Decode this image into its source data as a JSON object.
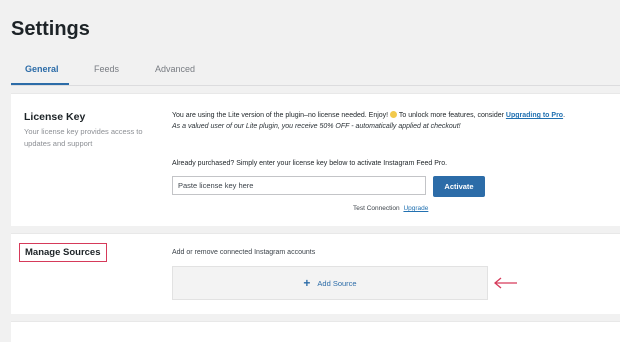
{
  "page": {
    "title": "Settings"
  },
  "tabs": [
    {
      "label": "General",
      "active": true
    },
    {
      "label": "Feeds",
      "active": false
    },
    {
      "label": "Advanced",
      "active": false
    }
  ],
  "license": {
    "title": "License Key",
    "description": "Your license key provides access to updates and support",
    "notice_prefix": "You are using the Lite version of the plugin–no license needed. Enjoy!",
    "notice_middle": " To unlock more features, consider ",
    "upgrade_link": "Upgrading to Pro",
    "notice_period": ".",
    "notice_line2": "As a valued user of our Lite plugin, you receive 50% OFF - automatically applied at checkout!",
    "already": "Already purchased? Simply enter your license key below to activate Instagram Feed Pro.",
    "input_placeholder": "Paste license key here",
    "input_value": "",
    "activate_label": "Activate",
    "test_connection": "Test Connection",
    "upgrade_small": "Upgrade"
  },
  "sources": {
    "title": "Manage Sources",
    "description": "Add or remove connected Instagram accounts",
    "add_source_label": "Add Source",
    "add_source_icon": "plus-icon"
  },
  "colors": {
    "accent": "#2c6ca8",
    "highlight": "#d63a5a",
    "smiley": "#f2c94c"
  }
}
